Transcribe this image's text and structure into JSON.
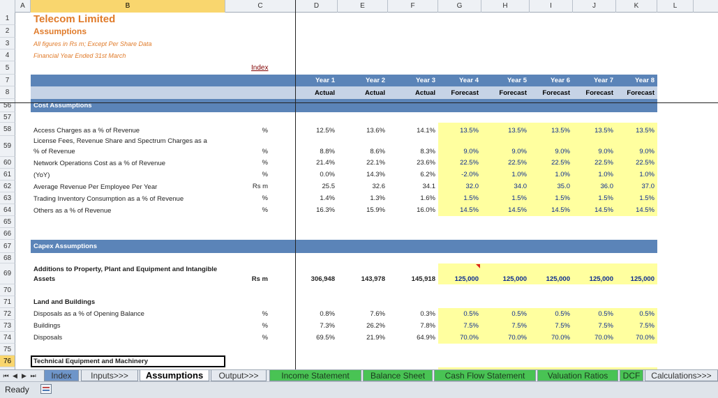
{
  "columns": [
    "A",
    "B",
    "C",
    "D",
    "E",
    "F",
    "G",
    "H",
    "I",
    "J",
    "K",
    "L"
  ],
  "company": "Telecom Limited",
  "subtitle": "Assumptions",
  "note1": "All figures in Rs m; Except Per Share Data",
  "note2": "Financial Year Ended 31st March",
  "index_link": "Index",
  "years": [
    "Year 1",
    "Year 2",
    "Year 3",
    "Year 4",
    "Year 5",
    "Year 6",
    "Year 7",
    "Year 8"
  ],
  "periods": [
    "Actual",
    "Actual",
    "Actual",
    "Forecast",
    "Forecast",
    "Forecast",
    "Forecast",
    "Forecast"
  ],
  "sections": {
    "cost": "Cost Assumptions",
    "capex": "Capex Assumptions"
  },
  "rows": [
    {
      "rn": "58",
      "label": "Access Charges as a % of Revenue",
      "label_top": "",
      "unit": "%",
      "vals": [
        "12.5%",
        "13.6%",
        "14.1%",
        "13.5%",
        "13.5%",
        "13.5%",
        "13.5%",
        "13.5%"
      ]
    },
    {
      "rn": "59",
      "label": "% of Revenue",
      "label_top": "License Fees, Revenue Share and Spectrum Charges as a",
      "unit": "%",
      "vals": [
        "8.8%",
        "8.6%",
        "8.3%",
        "9.0%",
        "9.0%",
        "9.0%",
        "9.0%",
        "9.0%"
      ]
    },
    {
      "rn": "60",
      "label": "Network Operations Cost as a % of Revenue",
      "label_top": "",
      "unit": "%",
      "vals": [
        "21.4%",
        "22.1%",
        "23.6%",
        "22.5%",
        "22.5%",
        "22.5%",
        "22.5%",
        "22.5%"
      ]
    },
    {
      "rn": "61",
      "label": "(YoY)",
      "label_top": "",
      "unit": "%",
      "vals": [
        "0.0%",
        "14.3%",
        "6.2%",
        "-2.0%",
        "1.0%",
        "1.0%",
        "1.0%",
        "1.0%"
      ]
    },
    {
      "rn": "62",
      "label": "Average Revenue Per Employee Per Year",
      "label_top": "",
      "unit": "Rs m",
      "vals": [
        "25.5",
        "32.6",
        "34.1",
        "32.0",
        "34.0",
        "35.0",
        "36.0",
        "37.0"
      ]
    },
    {
      "rn": "63",
      "label": "Trading Inventory Consumption as a % of Revenue",
      "label_top": "",
      "unit": "%",
      "vals": [
        "1.4%",
        "1.3%",
        "1.6%",
        "1.5%",
        "1.5%",
        "1.5%",
        "1.5%",
        "1.5%"
      ]
    },
    {
      "rn": "64",
      "label": "Others as a % of Revenue",
      "label_top": "",
      "unit": "%",
      "vals": [
        "16.3%",
        "15.9%",
        "16.0%",
        "14.5%",
        "14.5%",
        "14.5%",
        "14.5%",
        "14.5%"
      ]
    }
  ],
  "capex_row": {
    "rn": "69",
    "label_top": "Additions to Property, Plant and Equipment and Intangible",
    "label": "Assets",
    "unit": "Rs m",
    "vals": [
      "306,948",
      "143,978",
      "145,918",
      "125,000",
      "125,000",
      "125,000",
      "125,000",
      "125,000"
    ]
  },
  "land_header": "Land and Buildings",
  "land_rows": [
    {
      "rn": "72",
      "label": "Disposals as a % of Opening Balance",
      "unit": "%",
      "vals": [
        "0.8%",
        "7.6%",
        "0.3%",
        "0.5%",
        "0.5%",
        "0.5%",
        "0.5%",
        "0.5%"
      ]
    },
    {
      "rn": "73",
      "label": "Buildings",
      "unit": "%",
      "vals": [
        "7.3%",
        "26.2%",
        "7.8%",
        "7.5%",
        "7.5%",
        "7.5%",
        "7.5%",
        "7.5%"
      ]
    },
    {
      "rn": "74",
      "label": "Disposals",
      "unit": "%",
      "vals": [
        "69.5%",
        "21.9%",
        "64.9%",
        "70.0%",
        "70.0%",
        "70.0%",
        "70.0%",
        "70.0%"
      ]
    }
  ],
  "tech_header": "Technical Equipment and Machinery",
  "row_numbers": {
    "r1": "1",
    "r2": "2",
    "r3": "3",
    "r4": "4",
    "r5": "5",
    "r7": "7",
    "r8": "8",
    "r56": "56",
    "r57": "57",
    "r65": "65",
    "r66": "66",
    "r67": "67",
    "r68": "68",
    "r70": "70",
    "r71": "71",
    "r75": "75",
    "r76": "76"
  },
  "tabs": [
    "Index",
    "Inputs>>>",
    "Assumptions",
    "Output>>>",
    "Income Statement",
    "Balance Sheet",
    "Cash Flow Statement",
    "Valuation Ratios",
    "DCF",
    "Calculations>>>"
  ],
  "status": "Ready",
  "colors": {
    "band": "#5b84b8",
    "forecast_fill": "#ffff9f",
    "title_orange": "#e07b2a",
    "tab_green": "#49c354",
    "tab_blue": "#6e95c9"
  }
}
